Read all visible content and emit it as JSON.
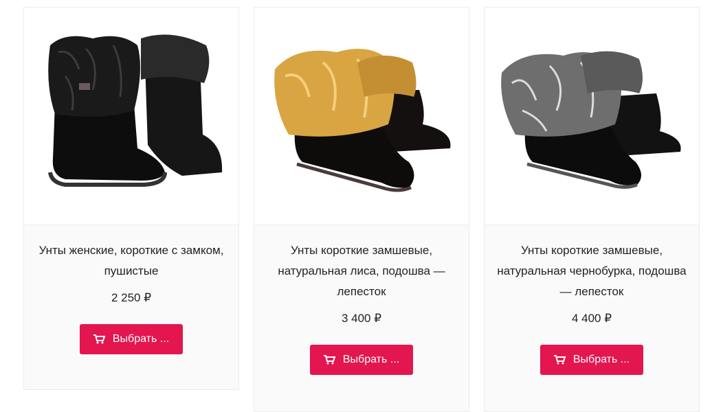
{
  "products": [
    {
      "title": "Унты женские, короткие с замком, пушистые",
      "price": "2 250 ₽",
      "button": "Выбрать ...",
      "fur_color": "#1a1a1a"
    },
    {
      "title": "Унты короткие замшевые, натуральная лиса, подошва — лепесток",
      "price": "3 400 ₽",
      "button": "Выбрать ...",
      "fur_color": "#d9a543"
    },
    {
      "title": "Унты короткие замшевые, натуральная чернобурка, подошва — лепесток",
      "price": "4 400 ₽",
      "button": "Выбрать ...",
      "fur_color": "#8a8a8a"
    }
  ],
  "colors": {
    "accent": "#e3164f",
    "card_bg": "#fafafa"
  },
  "icons": {
    "cart": "cart-icon"
  }
}
